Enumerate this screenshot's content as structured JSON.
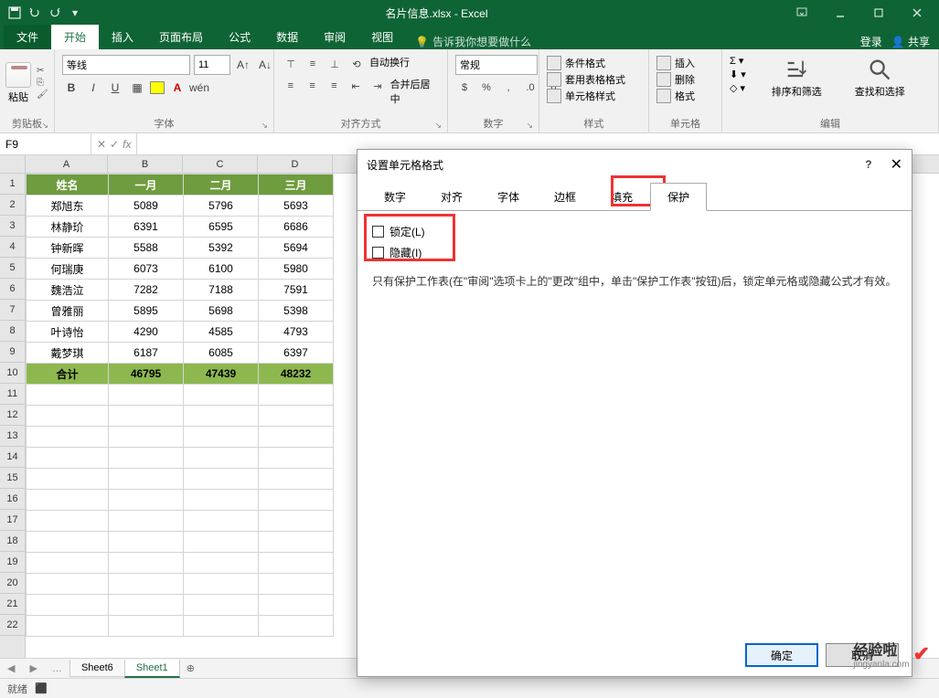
{
  "app": {
    "title": "名片信息.xlsx - Excel",
    "login": "登录",
    "share": "共享"
  },
  "ribbon_tabs": {
    "file": "文件",
    "home": "开始",
    "insert": "插入",
    "page_layout": "页面布局",
    "formulas": "公式",
    "data": "数据",
    "review": "审阅",
    "view": "视图",
    "tell_me": "告诉我你想要做什么"
  },
  "ribbon": {
    "clipboard": {
      "label": "剪贴板",
      "paste": "粘贴"
    },
    "font": {
      "label": "字体",
      "name": "等线",
      "size": "11"
    },
    "alignment": {
      "label": "对齐方式",
      "wrap": "自动换行",
      "merge": "合并后居中"
    },
    "number": {
      "label": "数字",
      "format": "常规"
    },
    "styles": {
      "label": "样式",
      "cond": "条件格式",
      "table": "套用表格格式",
      "cell": "单元格样式"
    },
    "cells": {
      "label": "单元格",
      "insert": "插入",
      "delete": "删除",
      "format": "格式"
    },
    "editing": {
      "label": "编辑",
      "sort": "排序和筛选",
      "find": "查找和选择"
    }
  },
  "namebox": "F9",
  "columns": [
    "A",
    "B",
    "C",
    "D"
  ],
  "rows": [
    "1",
    "2",
    "3",
    "4",
    "5",
    "6",
    "7",
    "8",
    "9",
    "10",
    "11",
    "12",
    "13",
    "14",
    "15",
    "16",
    "17",
    "18",
    "19",
    "20",
    "21",
    "22"
  ],
  "table": {
    "headers": [
      "姓名",
      "一月",
      "二月",
      "三月"
    ],
    "data": [
      [
        "郑旭东",
        "5089",
        "5796",
        "5693"
      ],
      [
        "林静玠",
        "6391",
        "6595",
        "6686"
      ],
      [
        "钟新晖",
        "5588",
        "5392",
        "5694"
      ],
      [
        "何瑞庚",
        "6073",
        "6100",
        "5980"
      ],
      [
        "魏浩泣",
        "7282",
        "7188",
        "7591"
      ],
      [
        "曾雅丽",
        "5895",
        "5698",
        "5398"
      ],
      [
        "叶诗怡",
        "4290",
        "4585",
        "4793"
      ],
      [
        "戴梦琪",
        "6187",
        "6085",
        "6397"
      ]
    ],
    "total": [
      "合计",
      "46795",
      "47439",
      "48232"
    ]
  },
  "sheets": {
    "s1": "Sheet6",
    "s2": "Sheet1"
  },
  "status": {
    "ready": "就绪"
  },
  "dialog": {
    "title": "设置单元格格式",
    "tabs": {
      "number": "数字",
      "alignment": "对齐",
      "font": "字体",
      "border": "边框",
      "fill": "填充",
      "protection": "保护"
    },
    "lock": "锁定(L)",
    "hidden": "隐藏(I)",
    "note": "只有保护工作表(在\"审阅\"选项卡上的\"更改\"组中，单击\"保护工作表\"按钮)后，锁定单元格或隐藏公式才有效。",
    "ok": "确定",
    "cancel": "取消"
  },
  "watermark": {
    "brand": "经验啦",
    "url": "jingyanla.com"
  },
  "chart_data": {
    "type": "table",
    "title": "名片信息",
    "columns": [
      "姓名",
      "一月",
      "二月",
      "三月"
    ],
    "rows": [
      {
        "姓名": "郑旭东",
        "一月": 5089,
        "二月": 5796,
        "三月": 5693
      },
      {
        "姓名": "林静玠",
        "一月": 6391,
        "二月": 6595,
        "三月": 6686
      },
      {
        "姓名": "钟新晖",
        "一月": 5588,
        "二月": 5392,
        "三月": 5694
      },
      {
        "姓名": "何瑞庚",
        "一月": 6073,
        "二月": 6100,
        "三月": 5980
      },
      {
        "姓名": "魏浩泣",
        "一月": 7282,
        "二月": 7188,
        "三月": 7591
      },
      {
        "姓名": "曾雅丽",
        "一月": 5895,
        "二月": 5698,
        "三月": 5398
      },
      {
        "姓名": "叶诗怡",
        "一月": 4290,
        "二月": 4585,
        "三月": 4793
      },
      {
        "姓名": "戴梦琪",
        "一月": 6187,
        "二月": 6085,
        "三月": 6397
      }
    ],
    "totals": {
      "一月": 46795,
      "二月": 47439,
      "三月": 48232
    }
  }
}
